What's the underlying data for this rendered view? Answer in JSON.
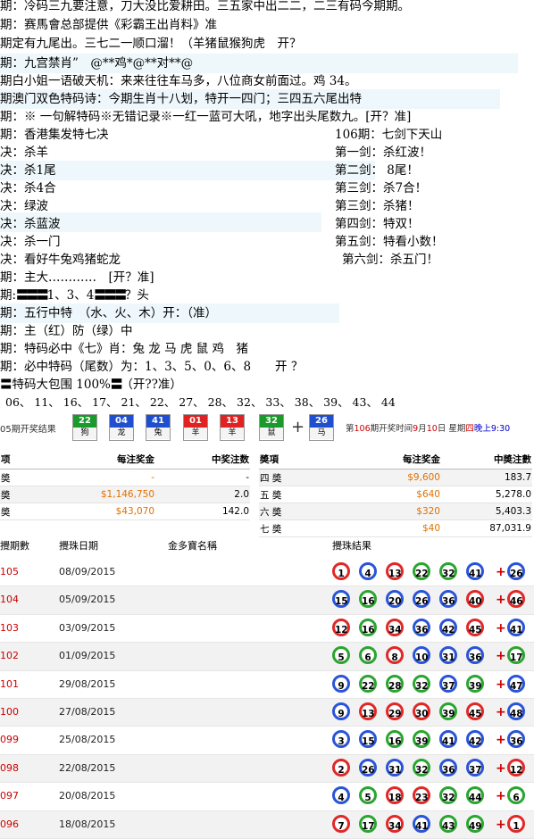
{
  "tips": [
    {
      "text": "期：冷码三九要注意，刀大没比爱耕田。三五家中出二二，二三有码今期期。"
    },
    {
      "text": "期：赛馬會总部提供《彩霸王出肖料》准"
    },
    {
      "text": "期定有九尾出。三七二一顺口溜！（羊猪鼠猴狗虎　开？"
    },
    {
      "text": "期：九宫禁肖”　@**鸡*@**对**@"
    },
    {
      "text": "期白小姐一语破天机：来来往往车马多，八位商女前面过。鸡 34。"
    },
    {
      "text": "期澳门双色特码诗：今期生肖十八划，特开一四门；三四五六尾出特"
    },
    {
      "text": "期：※ 一句解特码※无错记录※一红一蓝可大吼，地字出头尾数九。[开？准]"
    }
  ],
  "seven": {
    "title": "期：香港集发特七决",
    "items": [
      "决：杀羊",
      "决：杀1尾",
      "决：杀4合",
      "决：绿波",
      "决：杀蓝波",
      "决：杀一门",
      "决：看好牛兔鸡猪蛇龙"
    ]
  },
  "sword": {
    "title": "106期：七剑下天山",
    "items": [
      "第一剑：杀红波！",
      "第二剑： 8尾！",
      "第三剑：杀7合！",
      "第三剑：杀猪！",
      "第四剑：特双！",
      "第五剑：特看小数！",
      "第六剑：杀五门！"
    ]
  },
  "tips2": [
    {
      "text": "期：主大…………　[开？准]"
    },
    {
      "text_a": "期:",
      "bars_a": "〓〓〓",
      "text_b": "1、3、4",
      "bars_b": "〓〓〓",
      "text_c": "？头"
    },
    {
      "text": "期：五行中特　（水、火、木）开：（准）"
    },
    {
      "text": "期：主（红）防（绿）中"
    },
    {
      "text": "期：特码必中《七》肖：兔 龙 马 虎 鼠 鸡　猪"
    },
    {
      "text": "期：必中特码（尾数）为：1、3、5、0、6、8　　开 ？"
    },
    {
      "text_a": "〓特码大包围 100%",
      "bars_a": "〓",
      "text_b": "（开??准）"
    },
    {
      "text": "06、 11、 16、 17、 21、 22、 27、 28、 32、 33、 38、 39、 43、 44"
    }
  ],
  "latest": {
    "label": "05期开奖结果",
    "balls": [
      {
        "num": "22",
        "zodiac": "狗",
        "color": "#1a9a2a"
      },
      {
        "num": "04",
        "zodiac": "龙",
        "color": "#1f4fcf"
      },
      {
        "num": "41",
        "zodiac": "兔",
        "color": "#1f4fcf"
      },
      {
        "num": "01",
        "zodiac": "羊",
        "color": "#e02222"
      },
      {
        "num": "13",
        "zodiac": "羊",
        "color": "#e02222"
      },
      {
        "num": "32",
        "zodiac": "鼠",
        "color": "#1a9a2a"
      }
    ],
    "special": {
      "num": "26",
      "zodiac": "马",
      "color": "#1f4fcf"
    },
    "next_a": "第",
    "next_draw": "106",
    "next_b": "期开奖时间",
    "next_month": "9",
    "next_c": "月",
    "next_day": "10",
    "next_d": "日  星期",
    "next_week": "四",
    "next_time": "晚上9:30"
  },
  "prize": {
    "left_headers": [
      "项",
      "每注奖金",
      "中奖注数"
    ],
    "left_rows": [
      [
        "奬",
        "-",
        "-"
      ],
      [
        "奬",
        "$1,146,750",
        "2.0"
      ],
      [
        "奬",
        "$43,070",
        "142.0"
      ]
    ],
    "right_headers": [
      "奬項",
      "每注奖金",
      "中奬注數"
    ],
    "right_rows": [
      [
        "四 奬",
        "$9,600",
        "183.7"
      ],
      [
        "五 奬",
        "$640",
        "5,278.0"
      ],
      [
        "六 奬",
        "$320",
        "5,403.3"
      ],
      [
        "七 奬",
        "$40",
        "87,031.9"
      ]
    ]
  },
  "history": {
    "headers": [
      "攪期數",
      "攪珠日期",
      "金多寶名稱",
      "攪珠結果"
    ],
    "rows": [
      {
        "draw": "105",
        "date": "08/09/2015",
        "balls": [
          [
            "1",
            "r"
          ],
          [
            "4",
            "b"
          ],
          [
            "13",
            "r"
          ],
          [
            "22",
            "g"
          ],
          [
            "32",
            "g"
          ],
          [
            "41",
            "b"
          ]
        ],
        "special": [
          "26",
          "b"
        ]
      },
      {
        "draw": "104",
        "date": "05/09/2015",
        "balls": [
          [
            "15",
            "b"
          ],
          [
            "16",
            "g"
          ],
          [
            "20",
            "b"
          ],
          [
            "26",
            "b"
          ],
          [
            "36",
            "b"
          ],
          [
            "40",
            "r"
          ]
        ],
        "special": [
          "46",
          "r"
        ]
      },
      {
        "draw": "103",
        "date": "03/09/2015",
        "balls": [
          [
            "12",
            "r"
          ],
          [
            "16",
            "g"
          ],
          [
            "34",
            "r"
          ],
          [
            "36",
            "b"
          ],
          [
            "42",
            "b"
          ],
          [
            "45",
            "r"
          ]
        ],
        "special": [
          "41",
          "b"
        ]
      },
      {
        "draw": "102",
        "date": "01/09/2015",
        "balls": [
          [
            "5",
            "g"
          ],
          [
            "6",
            "g"
          ],
          [
            "8",
            "r"
          ],
          [
            "10",
            "b"
          ],
          [
            "31",
            "b"
          ],
          [
            "36",
            "b"
          ]
        ],
        "special": [
          "17",
          "g"
        ]
      },
      {
        "draw": "101",
        "date": "29/08/2015",
        "balls": [
          [
            "9",
            "b"
          ],
          [
            "22",
            "g"
          ],
          [
            "28",
            "g"
          ],
          [
            "32",
            "g"
          ],
          [
            "37",
            "b"
          ],
          [
            "39",
            "g"
          ]
        ],
        "special": [
          "47",
          "b"
        ]
      },
      {
        "draw": "100",
        "date": "27/08/2015",
        "balls": [
          [
            "9",
            "b"
          ],
          [
            "13",
            "r"
          ],
          [
            "29",
            "r"
          ],
          [
            "30",
            "r"
          ],
          [
            "39",
            "g"
          ],
          [
            "45",
            "r"
          ]
        ],
        "special": [
          "48",
          "b"
        ]
      },
      {
        "draw": "099",
        "date": "25/08/2015",
        "balls": [
          [
            "3",
            "b"
          ],
          [
            "15",
            "b"
          ],
          [
            "16",
            "g"
          ],
          [
            "39",
            "g"
          ],
          [
            "41",
            "b"
          ],
          [
            "42",
            "b"
          ]
        ],
        "special": [
          "36",
          "b"
        ]
      },
      {
        "draw": "098",
        "date": "22/08/2015",
        "balls": [
          [
            "2",
            "r"
          ],
          [
            "26",
            "b"
          ],
          [
            "31",
            "b"
          ],
          [
            "32",
            "g"
          ],
          [
            "36",
            "b"
          ],
          [
            "37",
            "b"
          ]
        ],
        "special": [
          "12",
          "r"
        ]
      },
      {
        "draw": "097",
        "date": "20/08/2015",
        "balls": [
          [
            "4",
            "b"
          ],
          [
            "5",
            "g"
          ],
          [
            "18",
            "r"
          ],
          [
            "23",
            "r"
          ],
          [
            "32",
            "g"
          ],
          [
            "44",
            "g"
          ]
        ],
        "special": [
          "6",
          "g"
        ]
      },
      {
        "draw": "096",
        "date": "18/08/2015",
        "balls": [
          [
            "7",
            "r"
          ],
          [
            "17",
            "g"
          ],
          [
            "34",
            "r"
          ],
          [
            "41",
            "b"
          ],
          [
            "43",
            "g"
          ],
          [
            "49",
            "g"
          ]
        ],
        "special": [
          "1",
          "r"
        ]
      }
    ]
  }
}
